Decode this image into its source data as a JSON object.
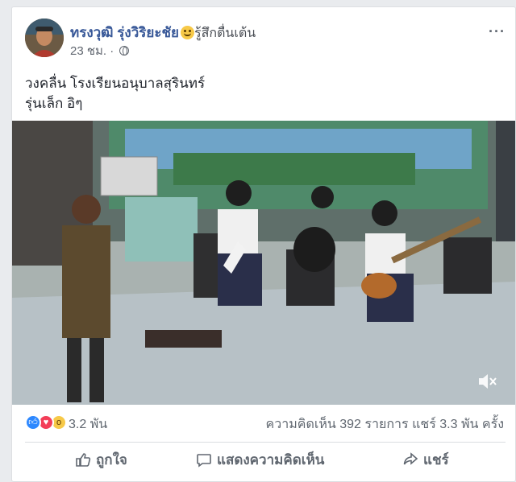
{
  "post": {
    "author": "ทรงวุฒิ รุ่งวิริยะชัย",
    "emoji_icon": "smiling-face-emoji",
    "feeling": "รู้สึกตื่นเต้น",
    "time": "23 ชม. · ",
    "privacy_icon": "globe-icon",
    "more_icon": "···",
    "text_lines": [
      "วงคลื่น โรงเรียนอนุบาลสุรินทร์",
      "รุ่นเล็ก อิๆ"
    ]
  },
  "video": {
    "mute_icon": "speaker-muted-icon"
  },
  "stats": {
    "reaction_icons": [
      "like",
      "love",
      "wow"
    ],
    "reaction_count": "3.2 พัน",
    "comments": "ความคิดเห็น 392 รายการ",
    "shares": "แชร์ 3.3 พัน ครั้ง"
  },
  "actions": {
    "like": "ถูกใจ",
    "comment": "แสดงความคิดเห็น",
    "share": "แชร์"
  },
  "colors": {
    "author_link": "#385898",
    "like_reaction": "#2d88ff",
    "love_reaction": "#f33e58",
    "wow_reaction": "#f7c948"
  }
}
